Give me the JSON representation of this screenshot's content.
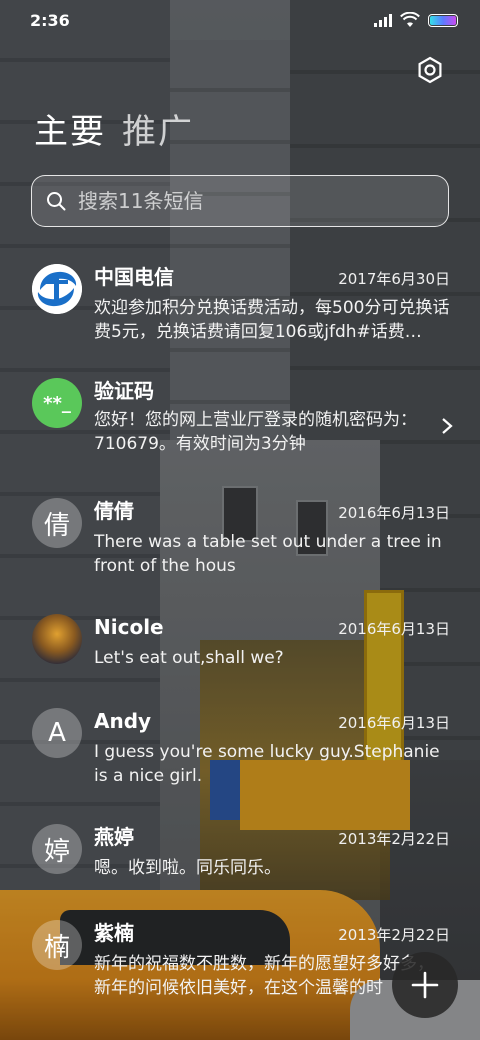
{
  "status": {
    "time": "2:36"
  },
  "tabs": [
    {
      "label": "主要"
    },
    {
      "label": "推广"
    }
  ],
  "search": {
    "placeholder": "搜索11条短信"
  },
  "conversations": [
    {
      "name": "中国电信",
      "date": "2017年6月30日",
      "avatar_type": "telecom-logo",
      "preview": "欢迎参加积分兑换话费活动，每500分可兑换话费5元，兑换话费请回复106或jfdh#话费…"
    },
    {
      "name": "验证码",
      "date": "",
      "avatar_text": "**_",
      "avatar_color": "#5ac85a",
      "preview": "您好！您的网上营业厅登录的随机密码为：710679。有效时间为3分钟"
    },
    {
      "name": "倩倩",
      "date": "2016年6月13日",
      "avatar_text": "倩",
      "preview": "There was a table set out under a tree in front of the hous"
    },
    {
      "name": "Nicole",
      "date": "2016年6月13日",
      "avatar_type": "photo",
      "preview": "Let's eat out,shall we?"
    },
    {
      "name": "Andy",
      "date": "2016年6月13日",
      "avatar_text": "A",
      "preview": "I guess you're some lucky guy.Stephanie is a nice girl."
    },
    {
      "name": "燕婷",
      "date": "2013年2月22日",
      "avatar_text": "婷",
      "preview": "嗯。收到啦。同乐同乐。"
    },
    {
      "name": "紫楠",
      "date": "2013年2月22日",
      "avatar_text": "楠",
      "preview": "新年的祝福数不胜数，新年的愿望好多好多，新年的问候依旧美好，在这个温馨的时"
    }
  ],
  "colors": {
    "accent_battery": "#5a7cff",
    "code_avatar": "#5ac85a",
    "telecom_blue": "#1a6fc8"
  },
  "icons": {
    "settings": "settings-icon",
    "search": "search-icon",
    "compose": "plus-icon",
    "chevron": "chevron-right-icon"
  }
}
